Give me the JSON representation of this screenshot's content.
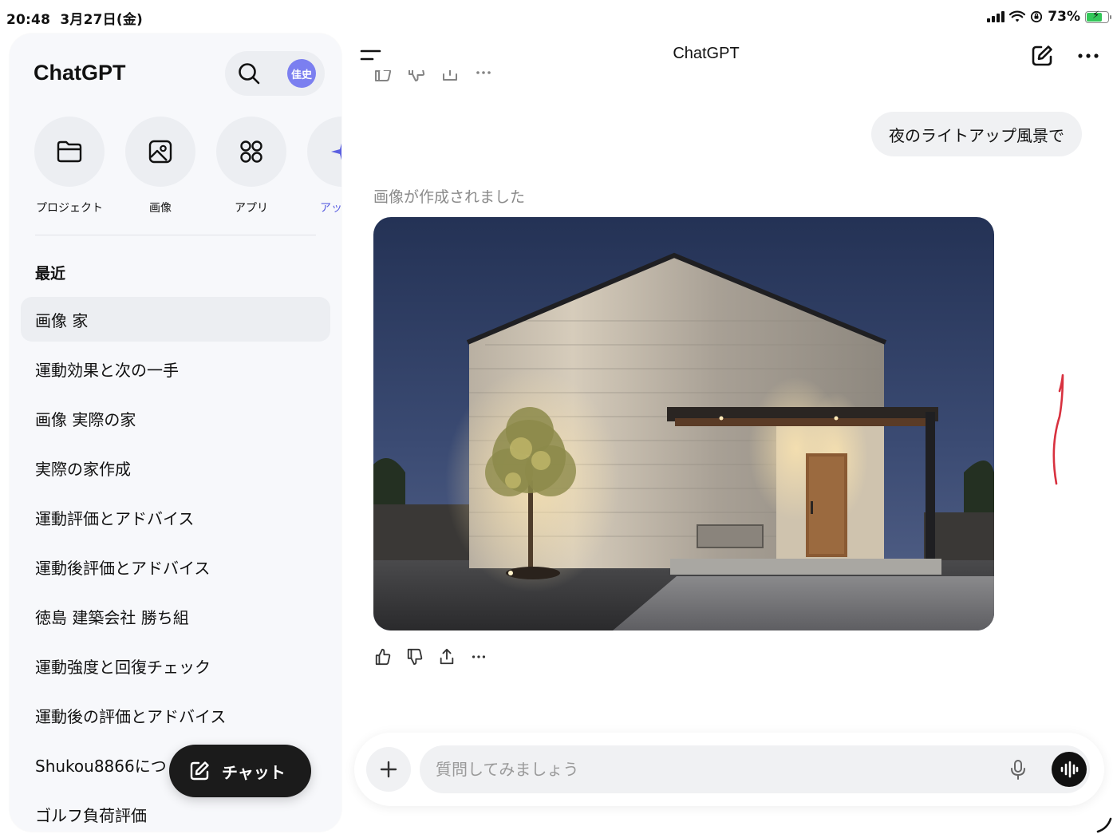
{
  "status_bar": {
    "time": "20:48",
    "date": "3月27日(金)",
    "battery": "73%",
    "battery_level": 0.73
  },
  "sidebar": {
    "title": "ChatGPT",
    "avatar_initials": "佳史",
    "shortcuts": [
      {
        "label": "プロジェクト",
        "icon": "folder-icon"
      },
      {
        "label": "画像",
        "icon": "image-icon"
      },
      {
        "label": "アプリ",
        "icon": "apps-grid-icon"
      },
      {
        "label": "アップグ",
        "icon": "upgrade-sparkle-icon"
      }
    ],
    "section_title": "最近",
    "recent": [
      "画像 家",
      "運動効果と次の一手",
      "画像 実際の家",
      "実際の家作成",
      "運動評価とアドバイス",
      "運動後評価とアドバイス",
      "徳島 建築会社 勝ち組",
      "運動強度と回復チェック",
      "運動後の評価とアドバイス",
      "Shukou8866につ",
      "ゴルフ負荷評価"
    ],
    "new_chat_label": "チャット"
  },
  "main": {
    "title": "ChatGPT",
    "user_message": "夜のライトアップ風景で",
    "image_caption": "画像が作成されました",
    "composer_placeholder": "質問してみましょう"
  },
  "colors": {
    "accent": "#5a5fe0",
    "avatar": "#7b7ff0",
    "annotation_red": "#d8313f"
  }
}
